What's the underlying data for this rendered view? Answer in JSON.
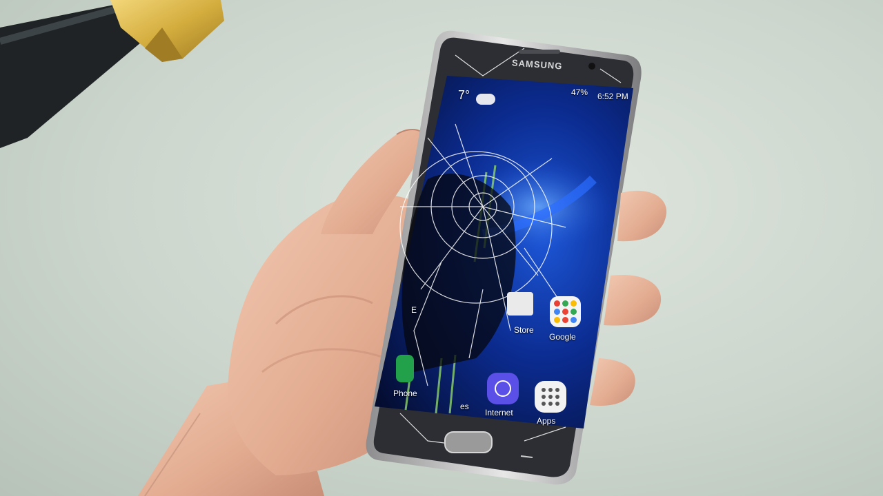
{
  "phone": {
    "brand": "SAMSUNG",
    "status": {
      "battery": "47%",
      "time": "6:52 PM"
    },
    "weather": {
      "temp": "7°"
    },
    "apps": {
      "phone": "Phone",
      "edge_partial": "E",
      "messages_partial": "es",
      "play_store_partial": "Store",
      "google": "Google",
      "internet": "Internet",
      "apps": "Apps"
    }
  },
  "colors": {
    "background": "#ccd6cd",
    "skin": "#e8b9a0",
    "screen_blue": "#0a2a8a",
    "hammer_brass": "#d9b64a"
  }
}
